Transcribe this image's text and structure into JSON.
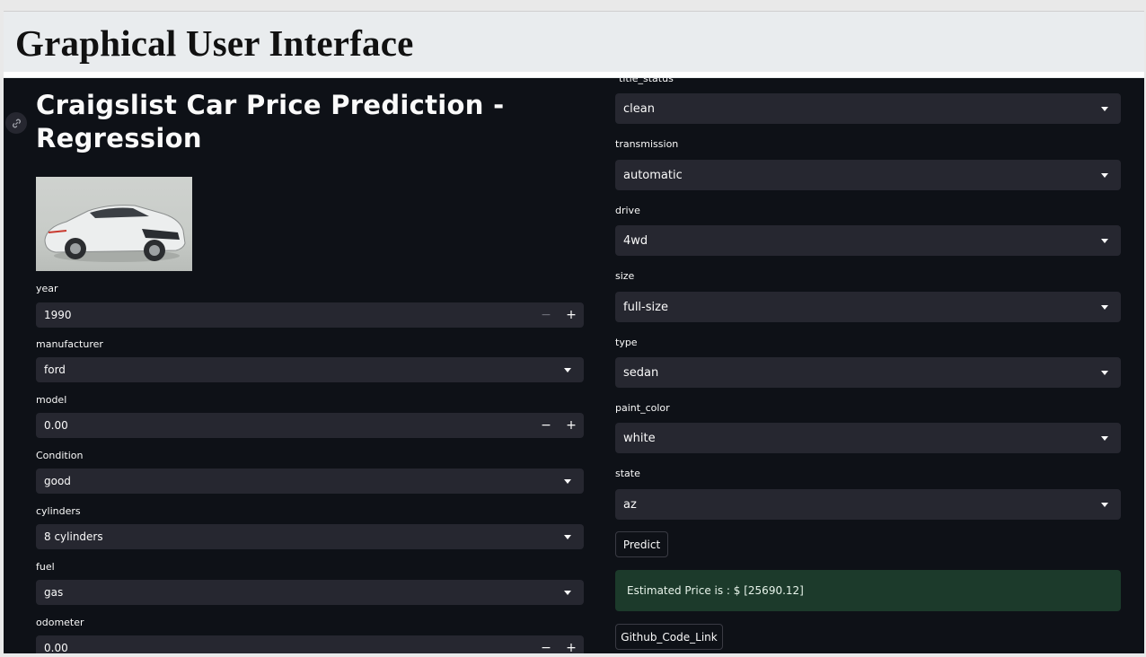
{
  "header": {
    "title": "Graphical User Interface"
  },
  "app": {
    "title": "Craigslist Car Price Prediction - Regression",
    "image_alt": "white sedan car"
  },
  "left_fields": [
    {
      "label": "year",
      "value": "1990",
      "kind": "number",
      "minus_disabled": true
    },
    {
      "label": "manufacturer",
      "value": "ford",
      "kind": "select"
    },
    {
      "label": "model",
      "value": "0.00",
      "kind": "number",
      "minus_disabled": false
    },
    {
      "label": "Condition",
      "value": "good",
      "kind": "select"
    },
    {
      "label": "cylinders",
      "value": "8 cylinders",
      "kind": "select"
    },
    {
      "label": "fuel",
      "value": "gas",
      "kind": "select"
    },
    {
      "label": "odometer",
      "value": "0.00",
      "kind": "number",
      "minus_disabled": false
    }
  ],
  "right_fields": [
    {
      "label": "title_status",
      "value": "clean"
    },
    {
      "label": "transmission",
      "value": "automatic"
    },
    {
      "label": "drive",
      "value": "4wd"
    },
    {
      "label": "size",
      "value": "full-size"
    },
    {
      "label": "type",
      "value": "sedan"
    },
    {
      "label": "paint_color",
      "value": "white"
    },
    {
      "label": "state",
      "value": "az"
    }
  ],
  "predict_label": "Predict",
  "result_text": "Estimated Price is : $ [25690.12]",
  "github_label": "Github_Code_Link",
  "stepper": {
    "minus": "−",
    "plus": "+"
  },
  "colors": {
    "app_bg": "#0e1117",
    "input_bg": "#262730",
    "success_bg": "#1c3a2b",
    "text": "#fafafa"
  }
}
